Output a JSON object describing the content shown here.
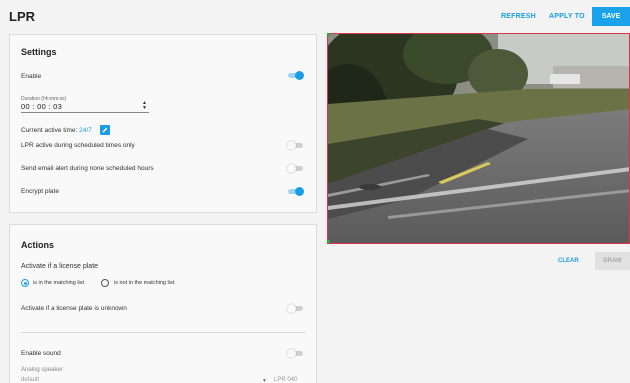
{
  "header": {
    "title": "LPR",
    "refresh_label": "REFRESH",
    "apply_to_label": "APPLY TO",
    "save_label": "SAVE"
  },
  "settings": {
    "title": "Settings",
    "enable_label": "Enable",
    "enable_on": true,
    "duration_label": "Duration (hh:mm:ss)",
    "duration_value": "00 : 00 : 03",
    "active_time_label": "Current active time:",
    "active_time_value": "24/7",
    "scheduled_only_label": "LPR active during scheduled times only",
    "scheduled_only_on": false,
    "email_alert_label": "Send email alert during none scheduled hours",
    "email_alert_on": false,
    "encrypt_label": "Encrypt plate",
    "encrypt_on": true
  },
  "actions": {
    "title": "Actions",
    "activate_label": "Activate if a license plate",
    "radio_in_list": "is in the matching list",
    "radio_not_in_list": "is not in the matching list",
    "selected_radio": "in_list",
    "unknown_label": "Activate if a license plate is unknown",
    "unknown_on": false,
    "sound_label": "Enable sound",
    "sound_on": false,
    "speaker_label": "Analog speaker",
    "speaker_value": "default",
    "speaker_extra": "LPR 040"
  },
  "preview": {
    "clear_label": "CLEAR",
    "draw_label": "DRAW"
  },
  "colors": {
    "accent": "#1a9de2",
    "roi_border": "#d9344a"
  },
  "icons": {
    "edit": "pencil-icon",
    "stepper": "stepper-arrows-icon",
    "dropdown": "caret-down-icon"
  }
}
